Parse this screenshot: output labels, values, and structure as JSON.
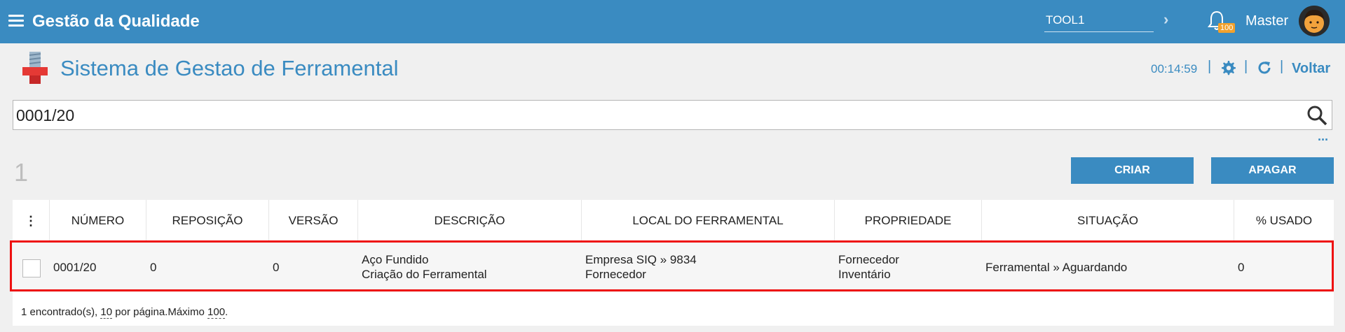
{
  "topbar": {
    "title": "Gestão da Qualidade",
    "tool_value": "TOOL1",
    "notification_count": "100",
    "user_name": "Master"
  },
  "header": {
    "page_title": "Sistema de Gestao de Ferramental",
    "timer": "00:14:59",
    "back_label": "Voltar"
  },
  "search": {
    "value": "0001/20"
  },
  "toolbar": {
    "count": "1",
    "create_label": "CRIAR",
    "delete_label": "APAGAR"
  },
  "table": {
    "columns": {
      "numero": "NÚMERO",
      "reposicao": "REPOSIÇÃO",
      "versao": "VERSÃO",
      "descricao": "DESCRIÇÃO",
      "local": "LOCAL DO FERRAMENTAL",
      "propriedade": "PROPRIEDADE",
      "situacao": "SITUAÇÃO",
      "usado": "% USADO"
    },
    "rows": [
      {
        "numero": "0001/20",
        "reposicao": "0",
        "versao": "0",
        "descricao_1": "Aço Fundido",
        "descricao_2": "Criação do Ferramental",
        "local_1": "Empresa SIQ » 9834",
        "local_2": "Fornecedor",
        "propriedade_1": "Fornecedor",
        "propriedade_2": "Inventário",
        "situacao": "Ferramental » Aguardando",
        "usado": "0"
      }
    ],
    "footer": {
      "found_text": "1 encontrado(s),",
      "per_page_value": "10",
      "per_page_text": "por página.Máximo",
      "max_value": "100",
      "end_text": "."
    }
  },
  "colors": {
    "primary": "#3a8bc1",
    "badge": "#f2a12c",
    "highlight": "#ee1111"
  }
}
